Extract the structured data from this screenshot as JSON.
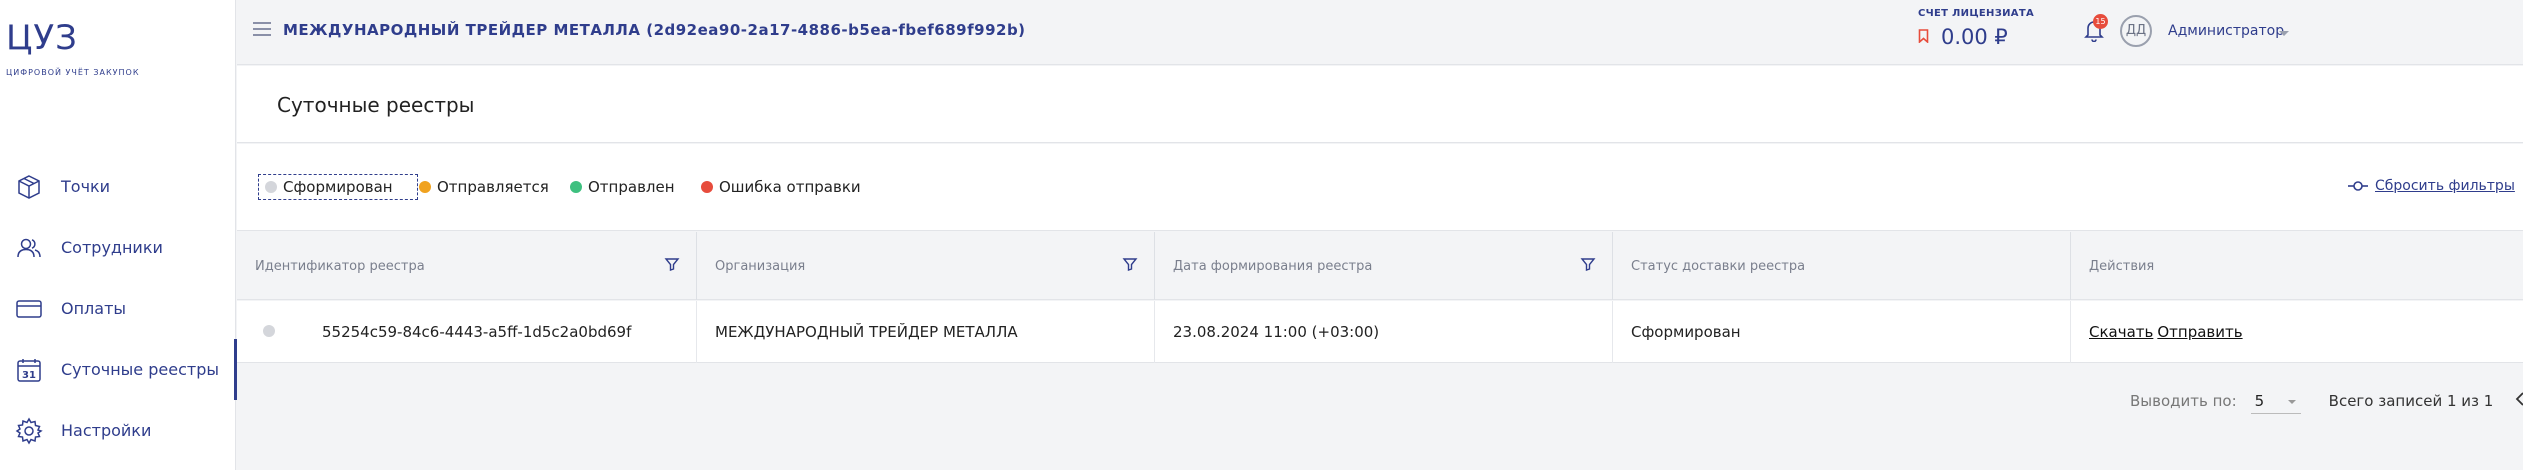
{
  "logo": {
    "main": "ЦУЗ",
    "sub": "ЦИФРОВОЙ УЧЁТ ЗАКУПОК"
  },
  "sidebar": {
    "items": [
      {
        "label": "Точки",
        "icon": "box-icon"
      },
      {
        "label": "Сотрудники",
        "icon": "users-icon"
      },
      {
        "label": "Оплаты",
        "icon": "card-icon"
      },
      {
        "label": "Суточные реестры",
        "icon": "calendar-icon",
        "icon_text": "31",
        "active": true
      },
      {
        "label": "Настройки",
        "icon": "gear-icon"
      }
    ]
  },
  "header": {
    "title": "МЕЖДУНАРОДНЫЙ ТРЕЙДЕР МЕТАЛЛА (2d92ea90-2a17-4886-b5ea-fbef689f992b)",
    "account_label": "СЧЕТ ЛИЦЕНЗИАТА",
    "account_value": "0.00 ₽",
    "notifications_count": "15",
    "avatar_initials": "ДД",
    "user_name": "Администратор"
  },
  "page": {
    "title": "Суточные реестры"
  },
  "filters": {
    "chips": [
      {
        "label": "Сформирован",
        "color": "#d4d6db",
        "selected": true
      },
      {
        "label": "Отправляется",
        "color": "#f0a21f"
      },
      {
        "label": "Отправлен",
        "color": "#3ec07f"
      },
      {
        "label": "Ошибка отправки",
        "color": "#e74c3c"
      }
    ],
    "reset_label": "Сбросить фильтры"
  },
  "table": {
    "columns": [
      {
        "label": "Идентификатор реестра",
        "filterable": true
      },
      {
        "label": "Организация",
        "filterable": true
      },
      {
        "label": "Дата формирования реестра",
        "filterable": true
      },
      {
        "label": "Статус доставки реестра",
        "filterable": false
      },
      {
        "label": "Действия",
        "filterable": false
      }
    ],
    "rows": [
      {
        "id": "55254c59-84c6-4443-a5ff-1d5c2a0bd69f",
        "organization": "МЕЖДУНАРОДНЫЙ ТРЕЙДЕР МЕТАЛЛА",
        "date": "23.08.2024 11:00 (+03:00)",
        "status": "Сформирован",
        "actions": [
          "Скачать",
          "Отправить"
        ]
      }
    ]
  },
  "pagination": {
    "per_page_label": "Выводить по:",
    "per_page_value": "5",
    "total": "Всего записей 1 из 1"
  },
  "colors": {
    "brand": "#2f3d8c",
    "accent_red": "#e74c3c"
  }
}
